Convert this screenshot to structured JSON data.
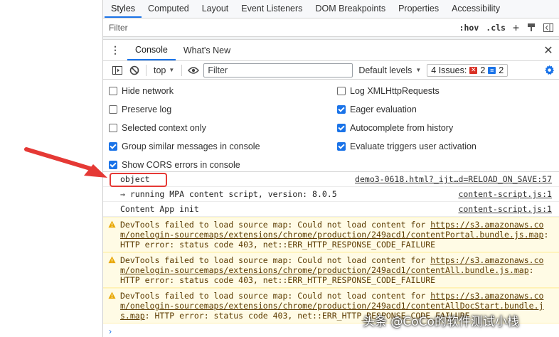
{
  "styles_tabs": [
    "Styles",
    "Computed",
    "Layout",
    "Event Listeners",
    "DOM Breakpoints",
    "Properties",
    "Accessibility"
  ],
  "styles_filter": {
    "placeholder": "Filter",
    "hov": ":hov",
    "cls": ".cls",
    "add": "+"
  },
  "drawer": {
    "tabs": [
      "Console",
      "What's New"
    ]
  },
  "toolbar": {
    "context": "top",
    "filter_placeholder": "Filter",
    "levels": "Default levels",
    "issues_label": "4 Issues:",
    "issues_errors": "2",
    "issues_info": "2"
  },
  "settings": {
    "left": [
      {
        "label": "Hide network",
        "checked": false
      },
      {
        "label": "Preserve log",
        "checked": false
      },
      {
        "label": "Selected context only",
        "checked": false
      },
      {
        "label": "Group similar messages in console",
        "checked": true
      },
      {
        "label": "Show CORS errors in console",
        "checked": true
      }
    ],
    "right": [
      {
        "label": "Log XMLHttpRequests",
        "checked": false
      },
      {
        "label": "Eager evaluation",
        "checked": true
      },
      {
        "label": "Autocomplete from history",
        "checked": true
      },
      {
        "label": "Evaluate triggers user activation",
        "checked": true
      }
    ]
  },
  "messages": [
    {
      "type": "log",
      "text": "object",
      "source": "demo3-0618.html?_ijt…d=RELOAD_ON_SAVE:57"
    },
    {
      "type": "log",
      "text": "→ running MPA content script, version: 8.0.5",
      "source": "content-script.js:1"
    },
    {
      "type": "log",
      "text": "Content App init",
      "source": "content-script.js:1"
    },
    {
      "type": "warn",
      "prefix": "DevTools failed to load source map: Could not load content for ",
      "link": "https://s3.amazonaws.com/onelogin-sourcemaps/extensions/chrome/production/249acd1/contentPortal.bundle.js.map",
      "suffix": ": HTTP error: status code 403, net::ERR_HTTP_RESPONSE_CODE_FAILURE"
    },
    {
      "type": "warn",
      "prefix": "DevTools failed to load source map: Could not load content for ",
      "link": "https://s3.amazonaws.com/onelogin-sourcemaps/extensions/chrome/production/249acd1/contentAll.bundle.js.map",
      "suffix": ": HTTP error: status code 403, net::ERR_HTTP_RESPONSE_CODE_FAILURE"
    },
    {
      "type": "warn",
      "prefix": "DevTools failed to load source map: Could not load content for ",
      "link": "https://s3.amazonaws.com/onelogin-sourcemaps/extensions/chrome/production/249acd1/contentAllDocStart.bundle.js.map",
      "suffix": ": HTTP error: status code 403, net::ERR_HTTP_RESPONSE_CODE_FAILURE"
    }
  ],
  "prompt": "›",
  "watermark": "头条 @CoCo的软件测试小栈",
  "colors": {
    "accent": "#1a73e8",
    "annotation": "#e53935",
    "warning_bg": "#fffbe5"
  }
}
